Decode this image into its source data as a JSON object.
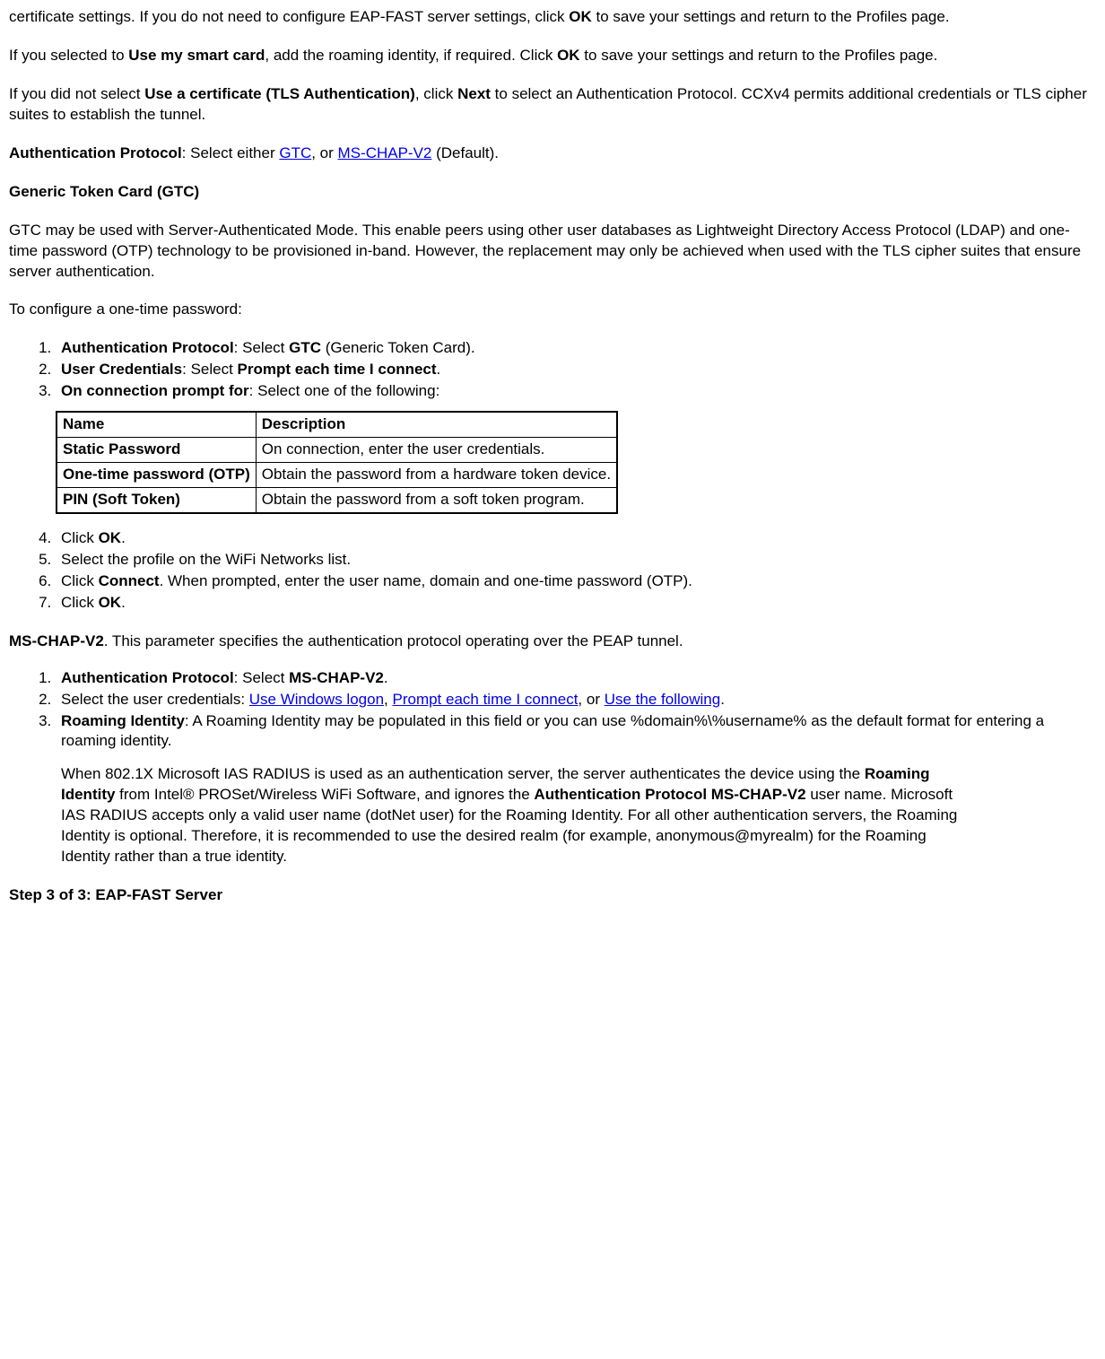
{
  "p1a": "certificate settings. If you do not need to configure EAP-FAST server settings, click ",
  "p1b": "OK",
  "p1c": " to save your settings and return to the Profiles page.",
  "p2a": "If you selected to ",
  "p2b": "Use my smart card",
  "p2c": ", add the roaming identity, if required. Click ",
  "p2d": "OK",
  "p2e": " to save your settings and return to the Profiles page.",
  "p3a": "If you did not select ",
  "p3b": "Use a certificate (TLS Authentication)",
  "p3c": ", click ",
  "p3d": "Next",
  "p3e": " to select an Authentication Protocol. CCXv4 permits additional credentials or TLS cipher suites to establish the tunnel.",
  "p4a": "Authentication Protocol",
  "p4b": ": Select either ",
  "p4_link1": "GTC",
  "p4c": ", or ",
  "p4_link2": "MS-CHAP-V2",
  "p4d": " (Default).",
  "gtc_hdr": "Generic Token Card (GTC)",
  "p5": "GTC may be used with Server-Authenticated Mode. This enable peers using other user databases as Lightweight Directory Access Protocol (LDAP) and one-time password (OTP) technology to be provisioned in-band. However, the replacement may only be achieved when used with the TLS cipher suites that ensure server authentication.",
  "p6": "To configure a one-time password:",
  "ol1": {
    "i1a": "Authentication Protocol",
    "i1b": ": Select ",
    "i1c": "GTC",
    "i1d": " (Generic Token Card).",
    "i2a": "User Credentials",
    "i2b": ": Select ",
    "i2c": "Prompt each time I connect",
    "i2d": ".",
    "i3a": "On connection prompt for",
    "i3b": ": Select one of the following:"
  },
  "table": {
    "h1": "Name",
    "h2": "Description",
    "r1c1": "Static Password",
    "r1c2": "On connection, enter the user credentials.",
    "r2c1": "One-time password (OTP)",
    "r2c2": "Obtain the password from a hardware token device.",
    "r3c1": "PIN (Soft Token)",
    "r3c2": "Obtain the password from a soft token program."
  },
  "ol2": {
    "i4a": "Click ",
    "i4b": "OK",
    "i4c": ".",
    "i5": "Select the profile on the WiFi Networks list.",
    "i6a": "Click ",
    "i6b": "Connect",
    "i6c": ". When prompted, enter the user name, domain and one-time password (OTP).",
    "i7a": "Click ",
    "i7b": "OK",
    "i7c": "."
  },
  "p7a": "MS-CHAP-V2",
  "p7b": ". This parameter specifies the authentication protocol operating over the PEAP tunnel.",
  "ol3": {
    "i1a": "Authentication Protocol",
    "i1b": ": Select ",
    "i1c": "MS-CHAP-V2",
    "i1d": ".",
    "i2a": "Select the user credentials: ",
    "i2_link1": "Use Windows logon",
    "i2b": ", ",
    "i2_link2": "Prompt each time I connect",
    "i2c": ", or ",
    "i2_link3": "Use the following",
    "i2d": ".",
    "i3a": "Roaming Identity",
    "i3b": ": A Roaming Identity may be populated in this field or you can use %domain%\\%username% as the default format for entering a roaming identity.",
    "i3p2a": "When 802.1X Microsoft IAS RADIUS is used as an authentication server, the server authenticates the device using the ",
    "i3p2b": "Roaming Identity",
    "i3p2c": " from Intel® PROSet/Wireless WiFi Software, and ignores the ",
    "i3p2d": "Authentication Protocol MS-CHAP-V2",
    "i3p2e": " user name. Microsoft IAS RADIUS accepts only a valid user name (dotNet user) for the Roaming Identity. For all other authentication servers, the Roaming Identity is optional. Therefore, it is recommended to use the desired realm (for example, anonymous@myrealm) for the Roaming Identity rather than a true identity."
  },
  "step3_hdr": "Step 3 of 3: EAP-FAST Server"
}
